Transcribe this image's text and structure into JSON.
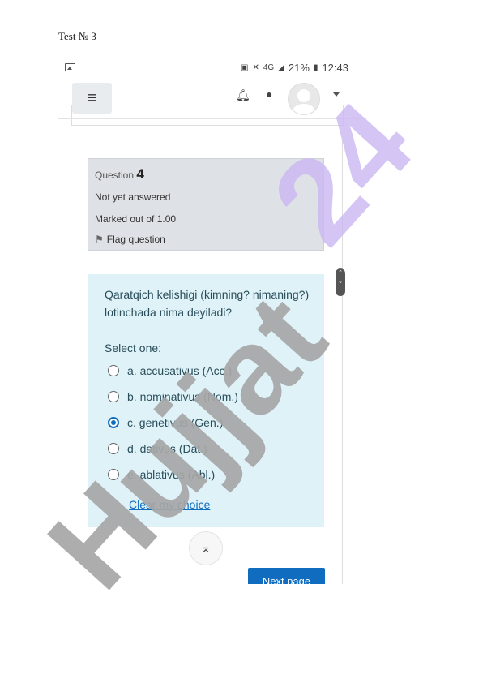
{
  "document": {
    "title": "Test № 3"
  },
  "status_bar": {
    "network": "4G",
    "battery": "21%",
    "time": "12:43"
  },
  "navbar": {
    "menu_icon": "hamburger-icon",
    "notification_icon": "bell-icon",
    "message_icon": "chat-icon",
    "avatar_icon": "user-avatar"
  },
  "question": {
    "label": "Question",
    "number": "4",
    "state": "Not yet answered",
    "grade": "Marked out of 1.00",
    "flag_label": "Flag question",
    "text": "Qaratqich kelishigi (kimning? nimaning?) lotinchada nima deyiladi?",
    "select_label": "Select one:",
    "options": [
      {
        "label": "a. accusativus (Acc.)",
        "selected": false
      },
      {
        "label": "b. nominativus (Nom.)",
        "selected": false
      },
      {
        "label": "c. genetivus (Gen.)",
        "selected": true
      },
      {
        "label": "d. dativus (Dat.)",
        "selected": false
      },
      {
        "label": "e. ablativus (Abl.)",
        "selected": false
      }
    ],
    "clear_label": "Clear my choice"
  },
  "buttons": {
    "next_label": "Next page"
  },
  "watermark": {
    "text": "Hujjat 24",
    "color_main": "#a6a6a6",
    "color_accent": "#c9b6f2"
  },
  "colors": {
    "accent": "#0f6cbf",
    "info_bg": "#dee2e6",
    "content_bg": "#def2f8"
  }
}
